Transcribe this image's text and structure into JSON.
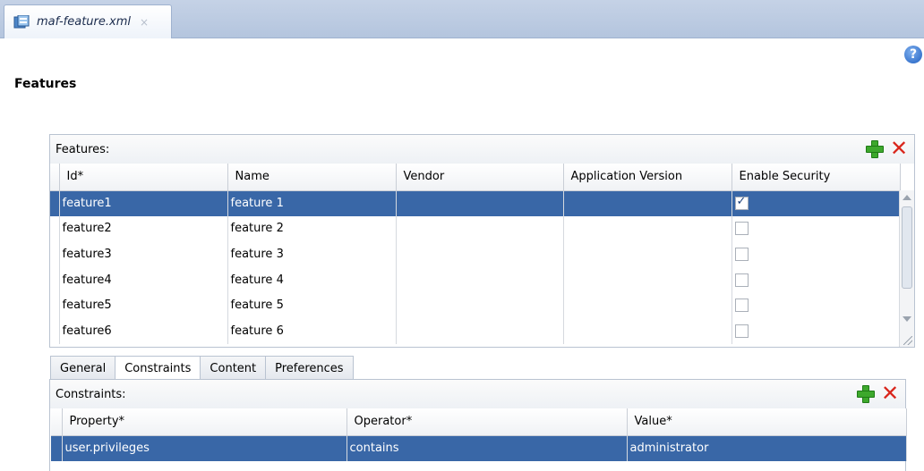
{
  "editor": {
    "tab_title": "maf-feature.xml",
    "tab_close": "×",
    "help": "?"
  },
  "page": {
    "title": "Features"
  },
  "features_panel": {
    "header": "Features:",
    "columns": [
      "Id*",
      "Name",
      "Vendor",
      "Application Version",
      "Enable Security"
    ],
    "rows": [
      {
        "id": "feature1",
        "name": "feature 1",
        "vendor": "",
        "app_version": "",
        "enable_security": true,
        "selected": true
      },
      {
        "id": "feature2",
        "name": "feature 2",
        "vendor": "",
        "app_version": "",
        "enable_security": false,
        "selected": false
      },
      {
        "id": "feature3",
        "name": "feature 3",
        "vendor": "",
        "app_version": "",
        "enable_security": false,
        "selected": false
      },
      {
        "id": "feature4",
        "name": "feature 4",
        "vendor": "",
        "app_version": "",
        "enable_security": false,
        "selected": false
      },
      {
        "id": "feature5",
        "name": "feature 5",
        "vendor": "",
        "app_version": "",
        "enable_security": false,
        "selected": false
      },
      {
        "id": "feature6",
        "name": "feature 6",
        "vendor": "",
        "app_version": "",
        "enable_security": false,
        "selected": false
      }
    ]
  },
  "subtabs": [
    {
      "label": "General",
      "active": false
    },
    {
      "label": "Constraints",
      "active": true
    },
    {
      "label": "Content",
      "active": false
    },
    {
      "label": "Preferences",
      "active": false
    }
  ],
  "constraints_panel": {
    "header": "Constraints:",
    "columns": [
      "Property*",
      "Operator*",
      "Value*"
    ],
    "rows": [
      {
        "property": "user.privileges",
        "operator": "contains",
        "value": "administrator",
        "selected": true
      }
    ]
  },
  "colors": {
    "selection": "#3967a7",
    "add_icon": "#3da82c",
    "delete_icon": "#d9261c"
  },
  "icons": {
    "add": "plus-icon",
    "delete": "delete-x-icon",
    "help": "help-icon",
    "file": "xml-file-icon"
  }
}
